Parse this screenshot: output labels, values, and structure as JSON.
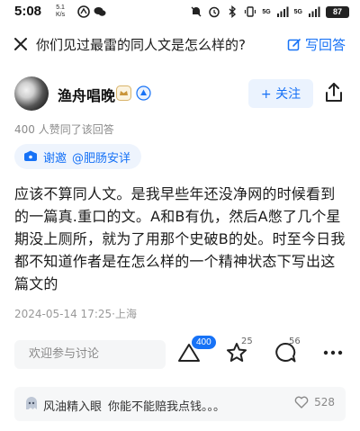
{
  "status_bar": {
    "time": "5:08",
    "net_speed_value": "5.1",
    "net_speed_unit": "K/s",
    "signal1_label": "5G",
    "signal2_label": "5G",
    "battery": "87"
  },
  "header": {
    "question_title": "你们见过最雷的同人文是怎么样的?",
    "write_answer_label": "写回答"
  },
  "author": {
    "name": "渔舟唱晚",
    "follow_label": "+ 关注"
  },
  "answer": {
    "agree_summary": "400 人赞同了该回答",
    "invite_label": "谢邀",
    "invite_user": "@肥肠安详",
    "content": "应该不算同人文。是我早些年还没净网的时候看到的一篇真.重口的文。A和B有仇，然后A憋了几个星期没上厕所，就为了用那个史破B的处。时至今日我都不知道作者是在怎么样的一个精神状态下写出这篇文的",
    "timestamp": "2024-05-14 17:25·上海"
  },
  "actions": {
    "comment_placeholder": "欢迎参与讨论",
    "agree_count": "400",
    "favorite_count": "25",
    "comment_count": "56"
  },
  "top_comment": {
    "user": "风油精入眼",
    "text": "你能不能赔我点钱。。。",
    "likes": "528"
  },
  "colors": {
    "accent": "#1772f6",
    "muted_text": "#8a8a8a"
  }
}
